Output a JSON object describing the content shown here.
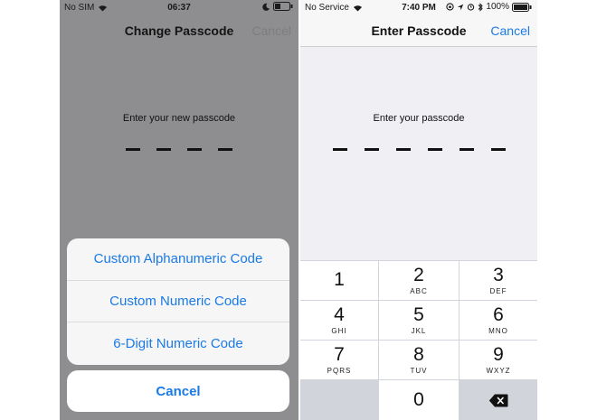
{
  "left": {
    "status": {
      "carrier": "No SIM",
      "time": "06:37"
    },
    "nav": {
      "title": "Change Passcode",
      "cancel": "Cancel"
    },
    "prompt": "Enter your new passcode",
    "options": [
      "Custom Alphanumeric Code",
      "Custom Numeric Code",
      "6-Digit Numeric Code"
    ],
    "cancel_button": "Cancel"
  },
  "right": {
    "status": {
      "carrier": "No Service",
      "time": "7:40 PM",
      "battery": "100%"
    },
    "nav": {
      "title": "Enter Passcode",
      "cancel": "Cancel"
    },
    "prompt": "Enter your passcode",
    "keys": [
      {
        "num": "1",
        "letters": ""
      },
      {
        "num": "2",
        "letters": "ABC"
      },
      {
        "num": "3",
        "letters": "DEF"
      },
      {
        "num": "4",
        "letters": "GHI"
      },
      {
        "num": "5",
        "letters": "JKL"
      },
      {
        "num": "6",
        "letters": "MNO"
      },
      {
        "num": "7",
        "letters": "PQRS"
      },
      {
        "num": "8",
        "letters": "TUV"
      },
      {
        "num": "9",
        "letters": "WXYZ"
      },
      {
        "num": "0",
        "letters": ""
      }
    ]
  },
  "colors": {
    "accent": "#1a7ae6",
    "dim_overlay": "#8e8e90",
    "keypad_bg": "#d1d5db"
  },
  "icons": [
    "wifi-icon",
    "moon-icon",
    "battery-icon",
    "location-arrow-icon",
    "alarm-icon",
    "bluetooth-icon",
    "lock-rotation-icon",
    "delete-key-icon"
  ]
}
